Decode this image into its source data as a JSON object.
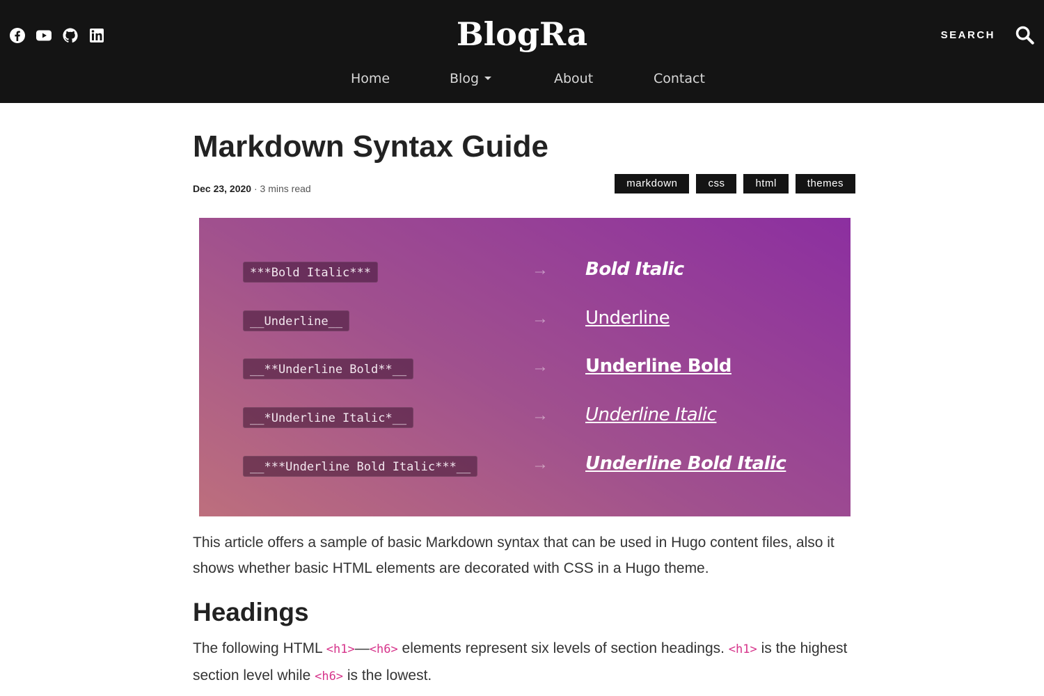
{
  "header": {
    "logo": "BlogRa",
    "search_label": "SEARCH",
    "social_icons": [
      "facebook-icon",
      "youtube-icon",
      "github-icon",
      "linkedin-icon"
    ],
    "nav": [
      {
        "label": "Home"
      },
      {
        "label": "Blog",
        "has_dropdown": true
      },
      {
        "label": "About"
      },
      {
        "label": "Contact"
      }
    ]
  },
  "article": {
    "title": "Markdown Syntax Guide",
    "date": "Dec 23, 2020",
    "separator": " · ",
    "read_time": "3 mins read",
    "tags": [
      "markdown",
      "css",
      "html",
      "themes"
    ],
    "hero": {
      "rows": [
        {
          "code": "***Bold Italic***",
          "arrow": "→",
          "result": "Bold Italic"
        },
        {
          "code": "__Underline__",
          "arrow": "→",
          "result": "Underline"
        },
        {
          "code": "__**Underline Bold**__",
          "arrow": "→",
          "result": "Underline Bold"
        },
        {
          "code": "__*Underline Italic*__",
          "arrow": "→",
          "result": "Underline Italic"
        },
        {
          "code": "__***Underline Bold Italic***__",
          "arrow": "→",
          "result": "Underline Bold Italic"
        }
      ]
    },
    "intro": "This article offers a sample of basic Markdown syntax that can be used in Hugo content files, also it shows whether basic HTML elements are decorated with CSS in a Hugo theme.",
    "headings_title": "Headings",
    "headings_para": {
      "t1": "The following HTML ",
      "c1": "<h1>",
      "dash": "—",
      "c2": "<h6>",
      "t2": " elements represent six levels of section headings. ",
      "c3": "<h1>",
      "t3": " is the highest section level while ",
      "c4": "<h6>",
      "t4": " is the lowest."
    }
  },
  "colors": {
    "header_bg": "#141414",
    "tag_bg": "#141414",
    "hero_gradient_start": "#bd6f7d",
    "hero_gradient_end": "#8c2fa0",
    "inline_code": "#d6338a"
  }
}
